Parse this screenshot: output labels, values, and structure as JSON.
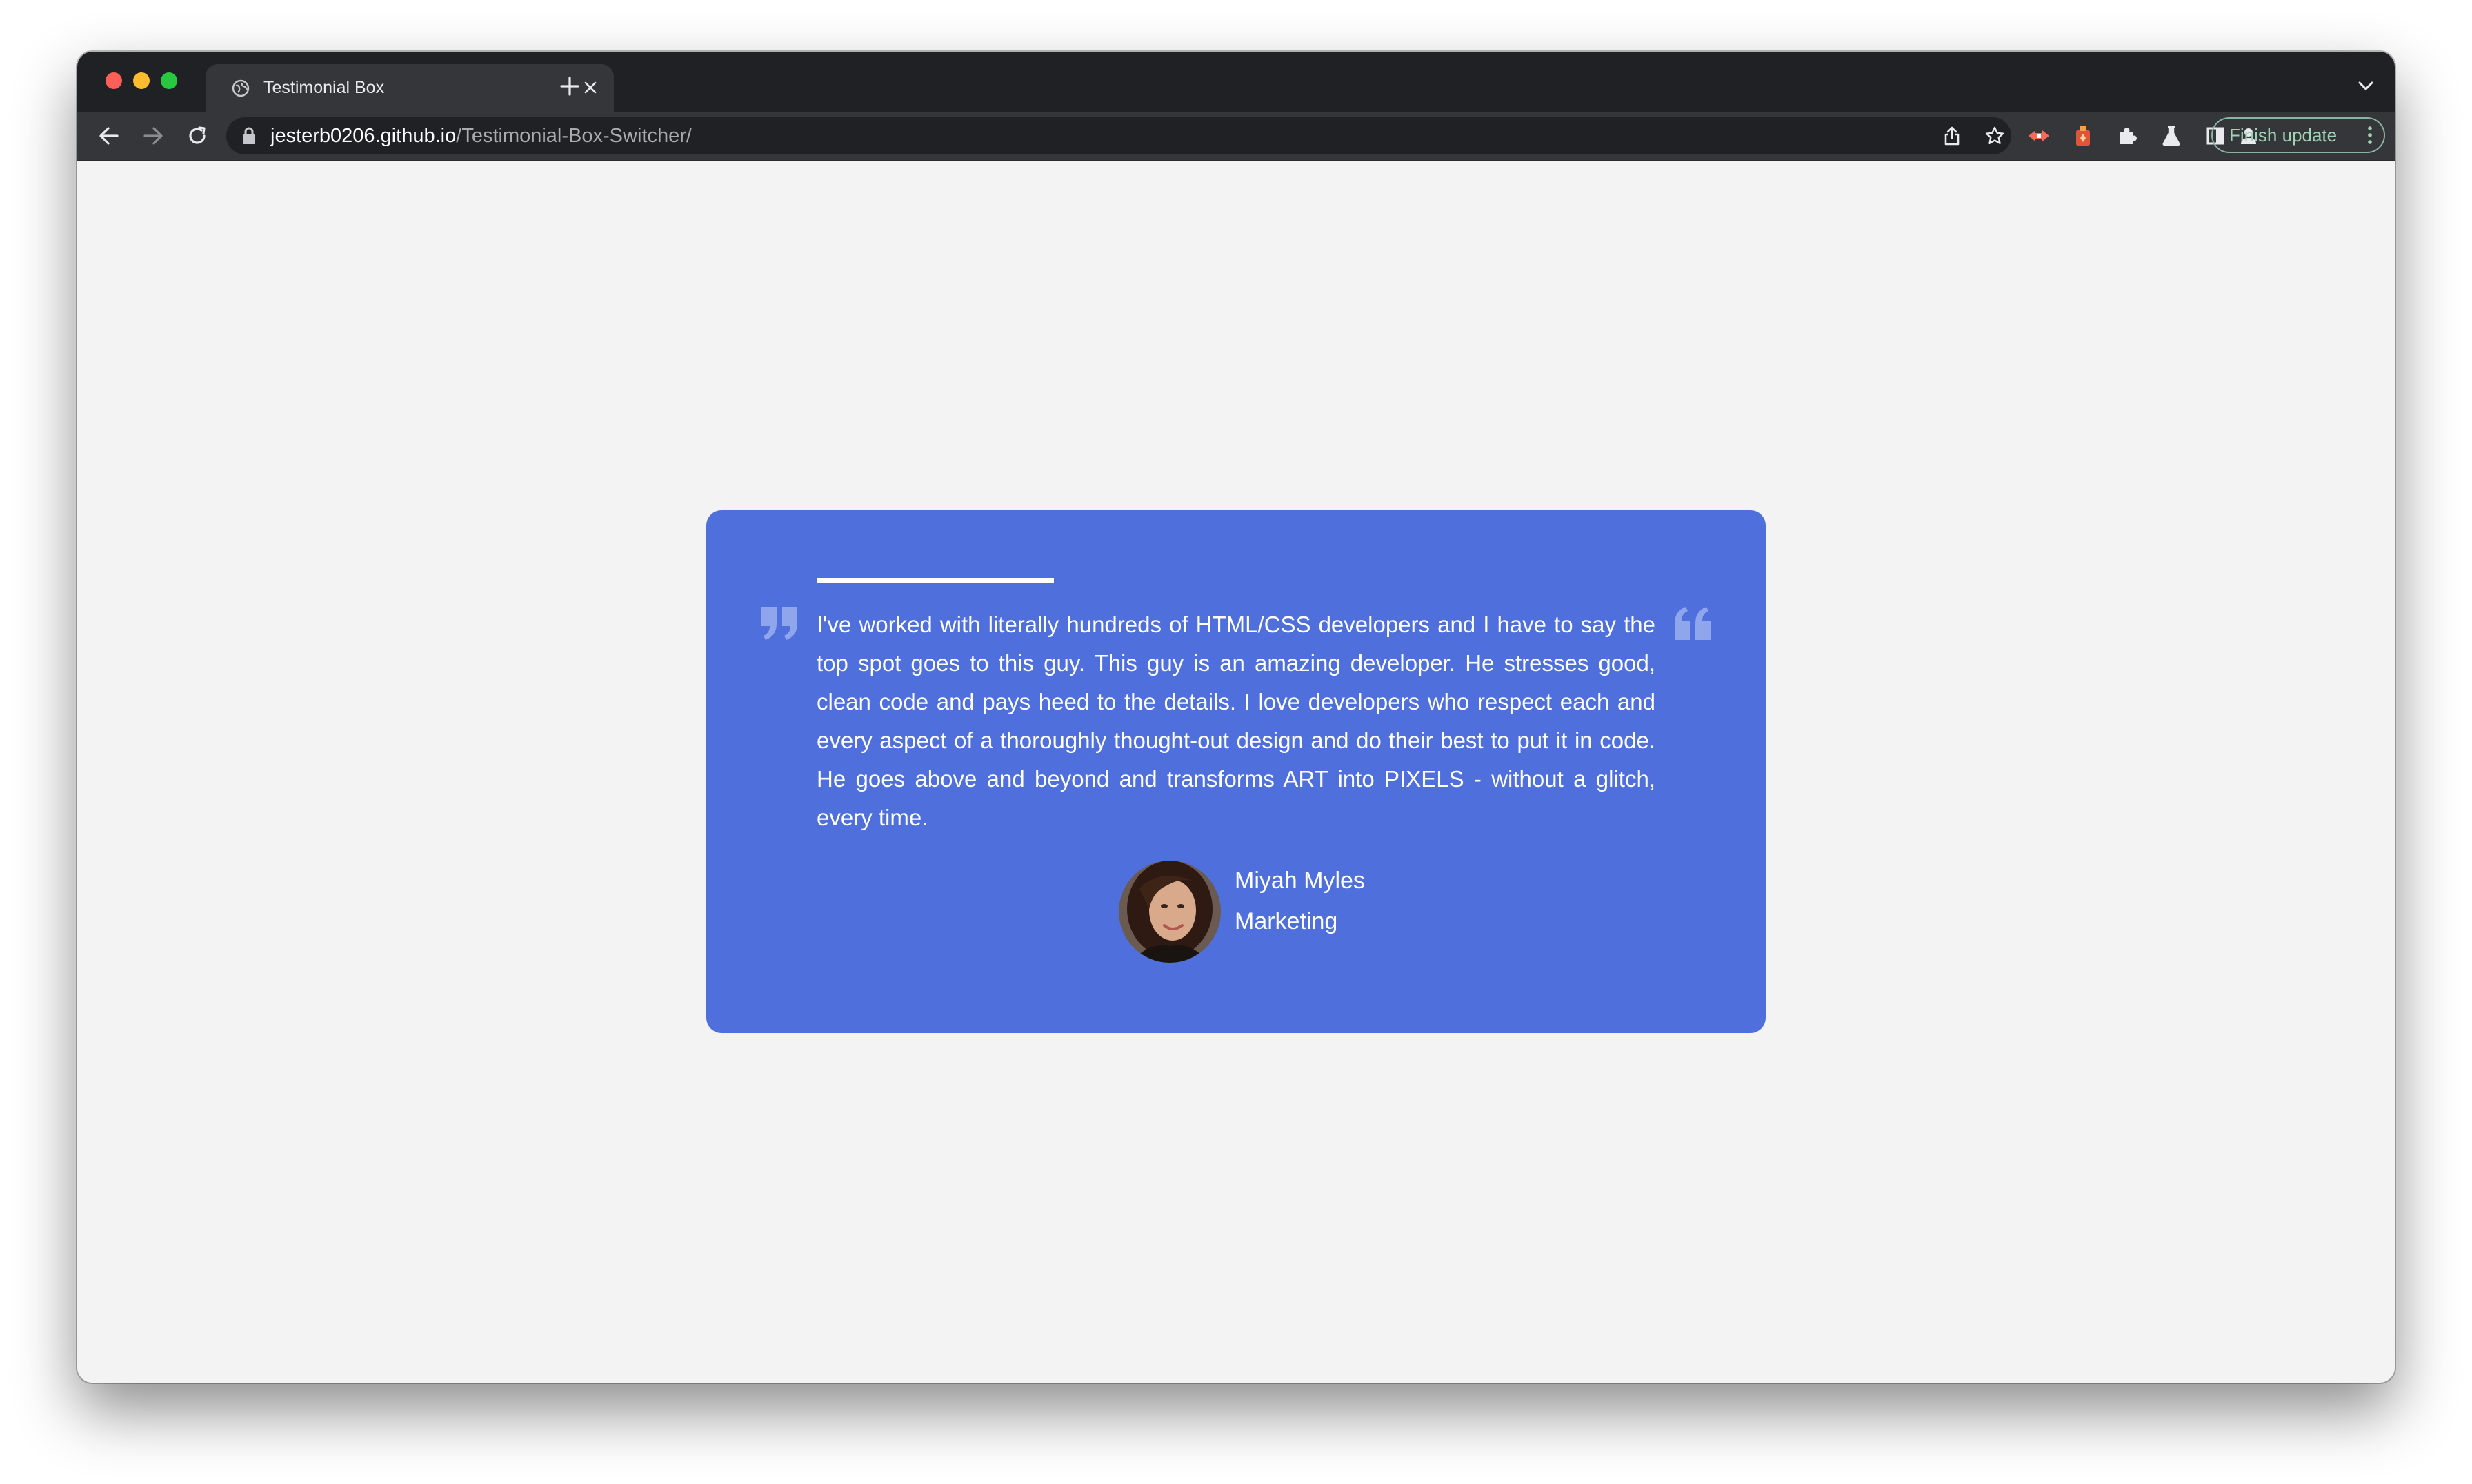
{
  "browser": {
    "tab": {
      "title": "Testimonial Box",
      "favicon": "globe-icon",
      "close_icon": "close-icon"
    },
    "new_tab_icon": "plus-icon",
    "tab_search_icon": "chevron-down-icon",
    "toolbar": {
      "back_icon": "back-arrow-icon",
      "forward_icon": "forward-arrow-icon",
      "reload_icon": "reload-icon",
      "lock_icon": "lock-icon",
      "url_host": "jesterb0206.github.io",
      "url_path": "/Testimonial-Box-Switcher/",
      "share_icon": "share-icon",
      "bookmark_icon": "star-icon",
      "extensions": [
        "extension-red-icon",
        "extension-orange-icon",
        "puzzle-icon",
        "flask-icon",
        "side-panel-icon",
        "profile-icon"
      ],
      "finish_update_label": "Finish update",
      "menu_icon": "kebab-menu-icon"
    }
  },
  "testimonial": {
    "text": "I've worked with literally hundreds of HTML/CSS developers and I have to say the top spot goes to this guy. This guy is an amazing developer. He stresses good, clean code and pays heed to the details. I love developers who respect each and every aspect of a thoroughly thought-out design and do their best to put it in code. He goes above and beyond and transforms ART into PIXELS - without a glitch, every time.",
    "name": "Miyah Myles",
    "role": "Marketing"
  },
  "colors": {
    "card_background": "#4f70dc",
    "page_background": "#f3f3f3",
    "quote_icon": "#8fa6ec"
  }
}
